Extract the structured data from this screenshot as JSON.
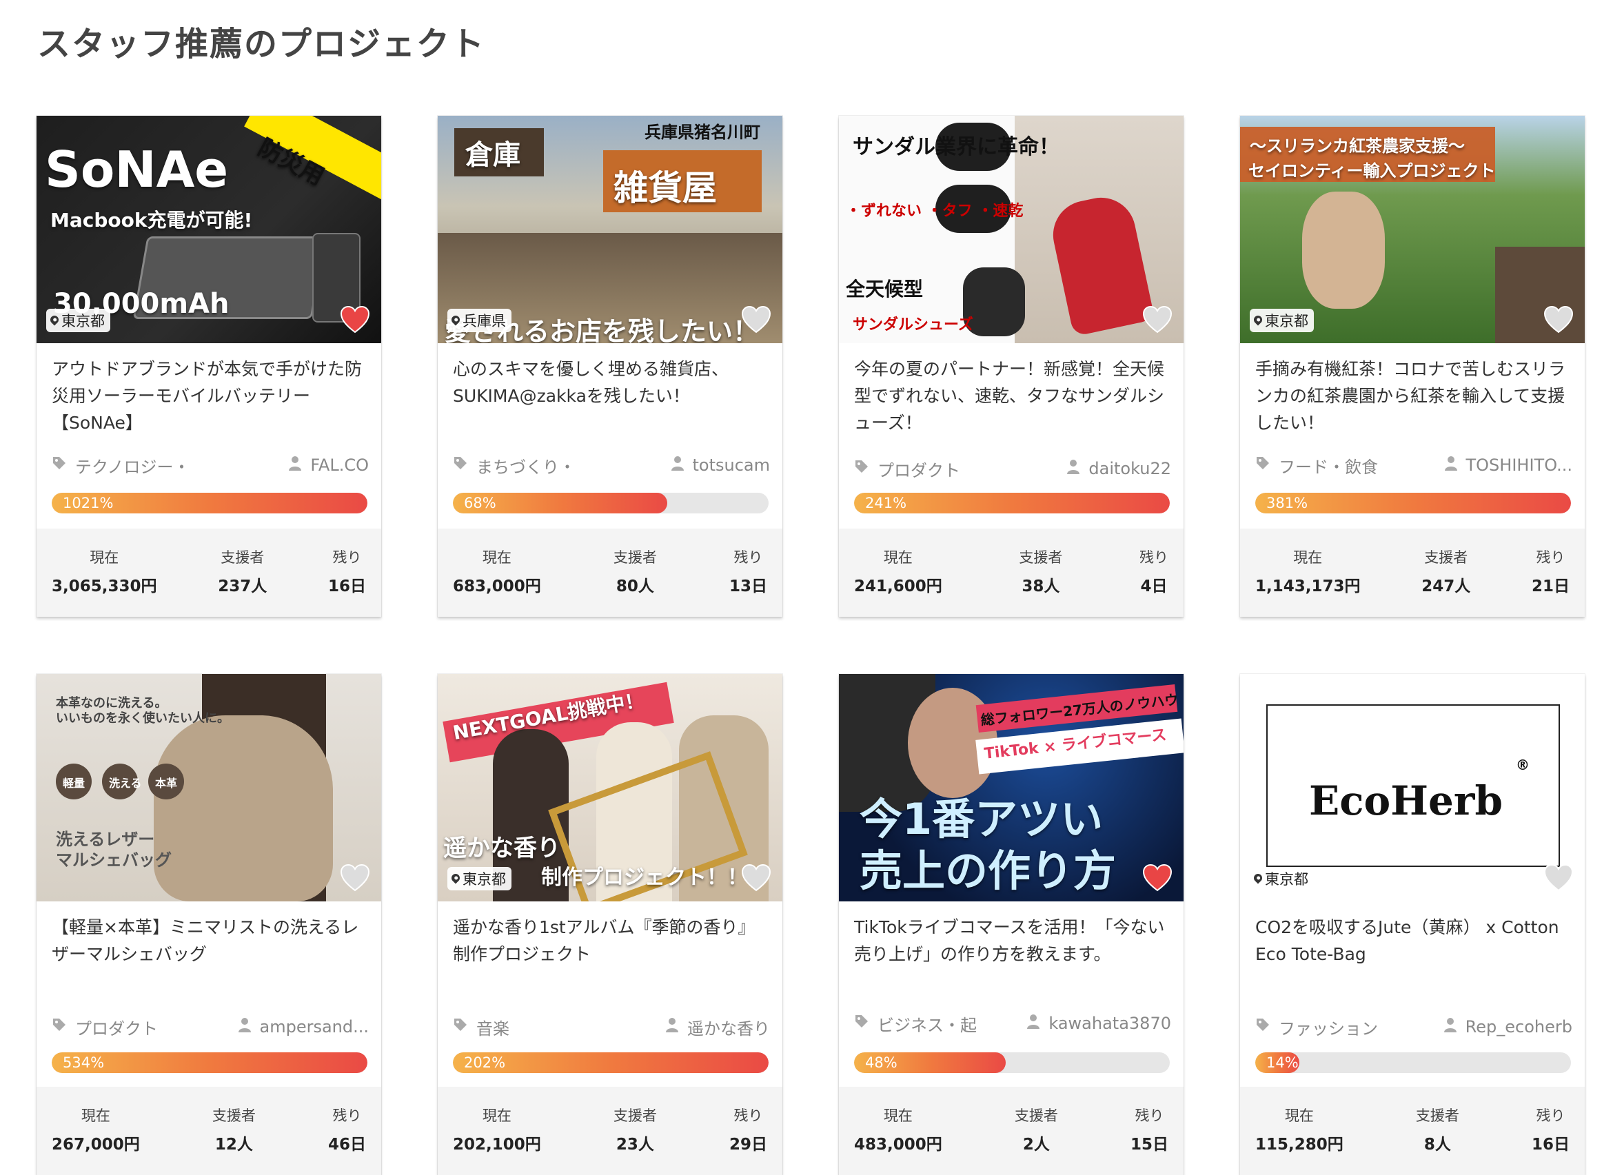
{
  "section_title": "スタッフ推薦のプロジェクト",
  "labels": {
    "current": "現在",
    "backers": "支援者",
    "remaining": "残り"
  },
  "colors": {
    "accent": "#ea4a45",
    "progress_start": "#f5b24a",
    "progress_end": "#ea4a45",
    "heart_filled": "#e94545",
    "heart_empty": "#dddddd"
  },
  "cards": [
    {
      "title": "アウトドアブランドが本気で手がけた防災用ソーラーモバイルバッテリー【SoNAe】",
      "category": "テクノロジー・",
      "owner": "FAL.CO",
      "percent_label": "1021%",
      "progress": 1.0,
      "current": "3,065,330円",
      "backers": "237人",
      "remaining": "16日",
      "location": "東京都",
      "favorited": true,
      "image_text": [
        "SoNAe",
        "防災用",
        "Macbook充電が可能!",
        "30,000mAh"
      ]
    },
    {
      "title": "心のスキマを優しく埋める雑貨店、SUKIMA@zakkaを残したい！",
      "category": "まちづくり・",
      "owner": "totsucam",
      "percent_label": "68%",
      "progress": 0.68,
      "current": "683,000円",
      "backers": "80人",
      "remaining": "13日",
      "location": "兵庫県",
      "favorited": false,
      "image_text": [
        "倉庫",
        "雑貨屋",
        "兵庫県猪名川町",
        "愛されるお店を残したい！"
      ]
    },
    {
      "title": "今年の夏のパートナー！新感覚！全天候型でずれない、速乾、タフなサンダルシューズ！",
      "category": "プロダクト",
      "owner": "daitoku22",
      "percent_label": "241%",
      "progress": 1.0,
      "current": "241,600円",
      "backers": "38人",
      "remaining": "4日",
      "location": "",
      "favorited": false,
      "image_text": [
        "サンダル業界に革命！",
        "・ずれない ・タフ ・速乾",
        "全天候型",
        "サンダルシューズ"
      ]
    },
    {
      "title": "手摘み有機紅茶！コロナで苦しむスリランカの紅茶農園から紅茶を輸入して支援したい！",
      "category": "フード・飲食",
      "owner": "TOSHIHITO...",
      "percent_label": "381%",
      "progress": 1.0,
      "current": "1,143,173円",
      "backers": "247人",
      "remaining": "21日",
      "location": "東京都",
      "favorited": false,
      "image_text": [
        "〜スリランカ紅茶農家支援〜",
        "セイロンティー輸入プロジェクト"
      ]
    },
    {
      "title": "【軽量×本革】ミニマリストの洗えるレザーマルシェバッグ",
      "category": "プロダクト",
      "owner": "ampersand...",
      "percent_label": "534%",
      "progress": 1.0,
      "current": "267,000円",
      "backers": "12人",
      "remaining": "46日",
      "location": "",
      "favorited": false,
      "image_text": [
        "本革なのに洗える。",
        "いいものを永く使いたい人に。",
        "軽量",
        "洗える",
        "本革",
        "洗えるレザー",
        "マルシェバッグ"
      ]
    },
    {
      "title": "遥かな香り1stアルバム『季節の香り』制作プロジェクト",
      "category": "音楽",
      "owner": "遥かな香り",
      "percent_label": "202%",
      "progress": 1.0,
      "current": "202,100円",
      "backers": "23人",
      "remaining": "29日",
      "location": "東京都",
      "favorited": false,
      "image_text": [
        "NEXTGOAL挑戦中！",
        "遥かな香り",
        "制作プロジェクト！！"
      ]
    },
    {
      "title": "TikTokライブコマースを活用！「今ない売り上げ」の作り方を教えます。",
      "category": "ビジネス・起",
      "owner": "kawahata3870",
      "percent_label": "48%",
      "progress": 0.48,
      "current": "483,000円",
      "backers": "2人",
      "remaining": "15日",
      "location": "",
      "favorited": true,
      "image_text": [
        "総フォロワー27万人のノウハウ",
        "TikTok × ライブコマース",
        "今1番アツい",
        "売上の作り方"
      ]
    },
    {
      "title": "CO2を吸収するJute（黄麻） x Cotton Eco Tote-Bag",
      "category": "ファッション",
      "owner": "Rep_ecoherb",
      "percent_label": "14%",
      "progress": 0.14,
      "current": "115,280円",
      "backers": "8人",
      "remaining": "16日",
      "location": "東京都",
      "favorited": false,
      "image_text": [
        "EcoHerb",
        "®"
      ]
    }
  ]
}
